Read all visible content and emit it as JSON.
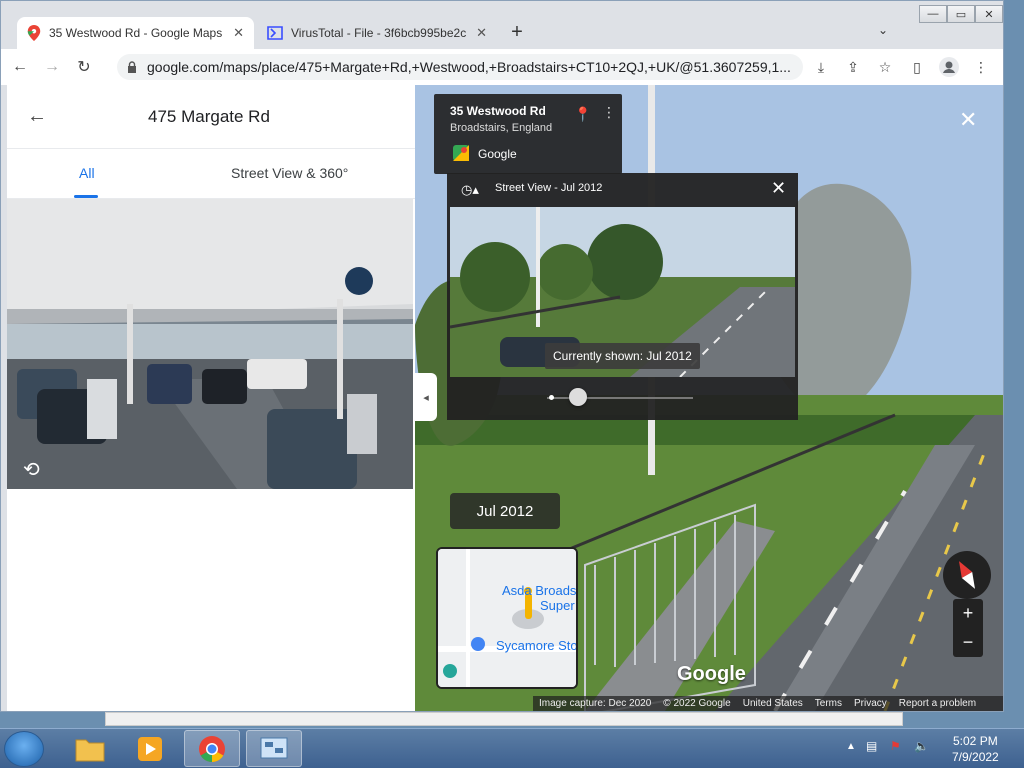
{
  "browser": {
    "tabs": [
      {
        "title": "35 Westwood Rd - Google Maps",
        "active": true
      },
      {
        "title": "VirusTotal - File - 3f6bcb995be2c",
        "active": false
      }
    ],
    "url": "google.com/maps/place/475+Margate+Rd,+Westwood,+Broadstairs+CT10+2QJ,+UK/@51.3607259,1...",
    "window_controls": [
      "—",
      "▭",
      "✕"
    ]
  },
  "left_panel": {
    "title": "475 Margate Rd",
    "tabs": [
      "All",
      "Street View & 360°"
    ],
    "active_tab": 0
  },
  "street_view": {
    "info_card": {
      "title": "35 Westwood Rd",
      "subtitle": "Broadstairs, England",
      "source": "Google"
    },
    "time_machine": {
      "title": "Street View - Jul 2012",
      "tooltip": "Currently shown: Jul 2012"
    },
    "date_badge": "Jul 2012",
    "minimap": {
      "label1": "Asda Broads",
      "label2": "Super",
      "label3": "Sycamore Sto"
    },
    "watermark": "Google",
    "footer": [
      "Image capture: Dec 2020",
      "© 2022 Google",
      "United States",
      "Terms",
      "Privacy",
      "Report a problem"
    ]
  },
  "taskbar": {
    "time": "5:02 PM",
    "date": "7/9/2022"
  },
  "colors": {
    "accent": "#1a73e8",
    "overlay": "#222222"
  }
}
